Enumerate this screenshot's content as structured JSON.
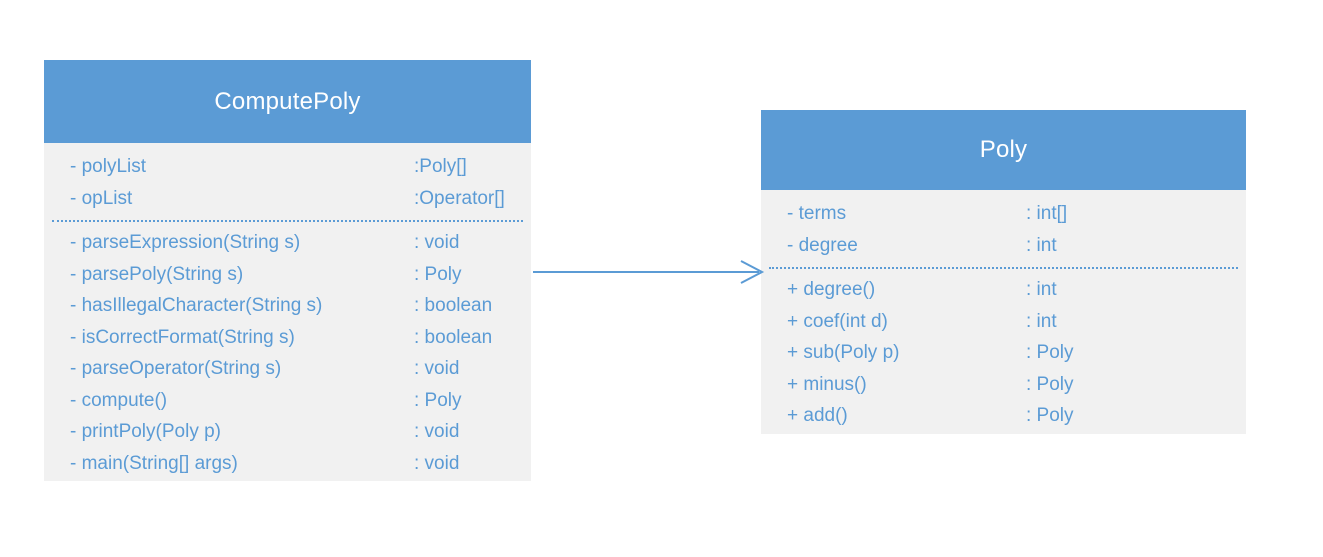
{
  "diagram": {
    "type": "uml-class-diagram",
    "colors": {
      "header_fill": "#5B9BD5",
      "body_fill": "#F1F1F1",
      "text": "#5B9BD5",
      "title_text": "#FFFFFF",
      "connector": "#5B9BD5",
      "canvas": "#FFFFFF"
    }
  },
  "classes": [
    {
      "id": "computepoly",
      "name": "ComputePoly",
      "attributes": [
        {
          "visibility": "-",
          "signature": "- polyList",
          "type": ":Poly[]"
        },
        {
          "visibility": "-",
          "signature": "- opList",
          "type": ":Operator[]"
        }
      ],
      "methods": [
        {
          "visibility": "-",
          "signature": "- parseExpression(String s)",
          "type": ": void"
        },
        {
          "visibility": "-",
          "signature": "- parsePoly(String s)",
          "type": ": Poly"
        },
        {
          "visibility": "-",
          "signature": "- hasIllegalCharacter(String s)",
          "type": ": boolean"
        },
        {
          "visibility": "-",
          "signature": "- isCorrectFormat(String s)",
          "type": ": boolean"
        },
        {
          "visibility": "-",
          "signature": "- parseOperator(String s)",
          "type": ": void"
        },
        {
          "visibility": "-",
          "signature": "- compute()",
          "type": ": Poly"
        },
        {
          "visibility": "-",
          "signature": "- printPoly(Poly p)",
          "type": ": void"
        },
        {
          "visibility": "-",
          "signature": "- main(String[] args)",
          "type": ": void"
        }
      ]
    },
    {
      "id": "poly",
      "name": "Poly",
      "attributes": [
        {
          "visibility": "-",
          "signature": "- terms",
          "type": ": int[]"
        },
        {
          "visibility": "-",
          "signature": "- degree",
          "type": ": int"
        }
      ],
      "methods": [
        {
          "visibility": "+",
          "signature": "+ degree()",
          "type": ": int"
        },
        {
          "visibility": "+",
          "signature": "+ coef(int d)",
          "type": ": int"
        },
        {
          "visibility": "+",
          "signature": "+ sub(Poly p)",
          "type": ": Poly"
        },
        {
          "visibility": "+",
          "signature": "+ minus()",
          "type": ": Poly"
        },
        {
          "visibility": "+",
          "signature": "+ add()",
          "type": ": Poly"
        }
      ]
    }
  ],
  "relationships": [
    {
      "id": "computepoly-to-poly",
      "kind": "association",
      "arrowhead": "open",
      "label": "",
      "from": "ComputePoly",
      "to": "Poly"
    }
  ]
}
